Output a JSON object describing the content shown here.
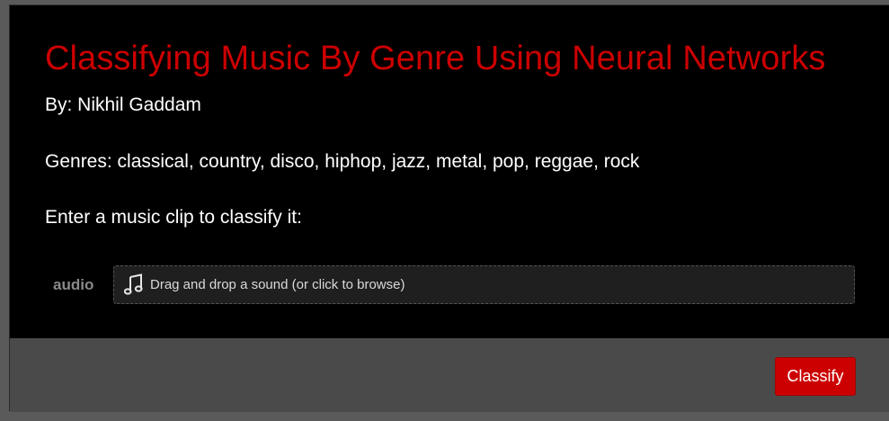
{
  "header": {
    "title": "Classifying Music By Genre Using Neural Networks",
    "byline": "By: Nikhil Gaddam"
  },
  "info": {
    "genres": "Genres: classical, country, disco, hiphop, jazz, metal, pop, reggae, rock",
    "prompt": "Enter a music clip to classify it:"
  },
  "input": {
    "label": "audio",
    "dropzone_text": "Drag and drop a sound (or click to browse)",
    "icon": "music-note-icon"
  },
  "footer": {
    "classify_label": "Classify"
  },
  "colors": {
    "accent": "#cc0000",
    "background": "#000000",
    "footer": "#4a4a4a"
  }
}
